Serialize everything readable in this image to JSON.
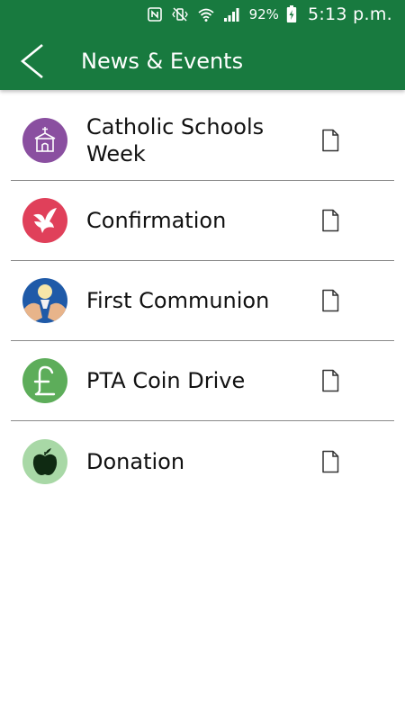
{
  "status_bar": {
    "battery_percent": "92%",
    "time": "5:13 p.m."
  },
  "app_bar": {
    "title": "News & Events"
  },
  "items": [
    {
      "label": "Catholic Schools Week",
      "icon": "church-icon",
      "color": "#8a4fa0"
    },
    {
      "label": "Confirmation",
      "icon": "dove-icon",
      "color": "#e0405a"
    },
    {
      "label": "First Communion",
      "icon": "communion-icon",
      "color": "#1f5aa8"
    },
    {
      "label": "PTA Coin Drive",
      "icon": "pound-icon",
      "color": "#5dad5a"
    },
    {
      "label": "Donation",
      "icon": "apple-icon",
      "color": "#a8d8a6"
    }
  ],
  "theme": {
    "primary": "#187a3f"
  }
}
